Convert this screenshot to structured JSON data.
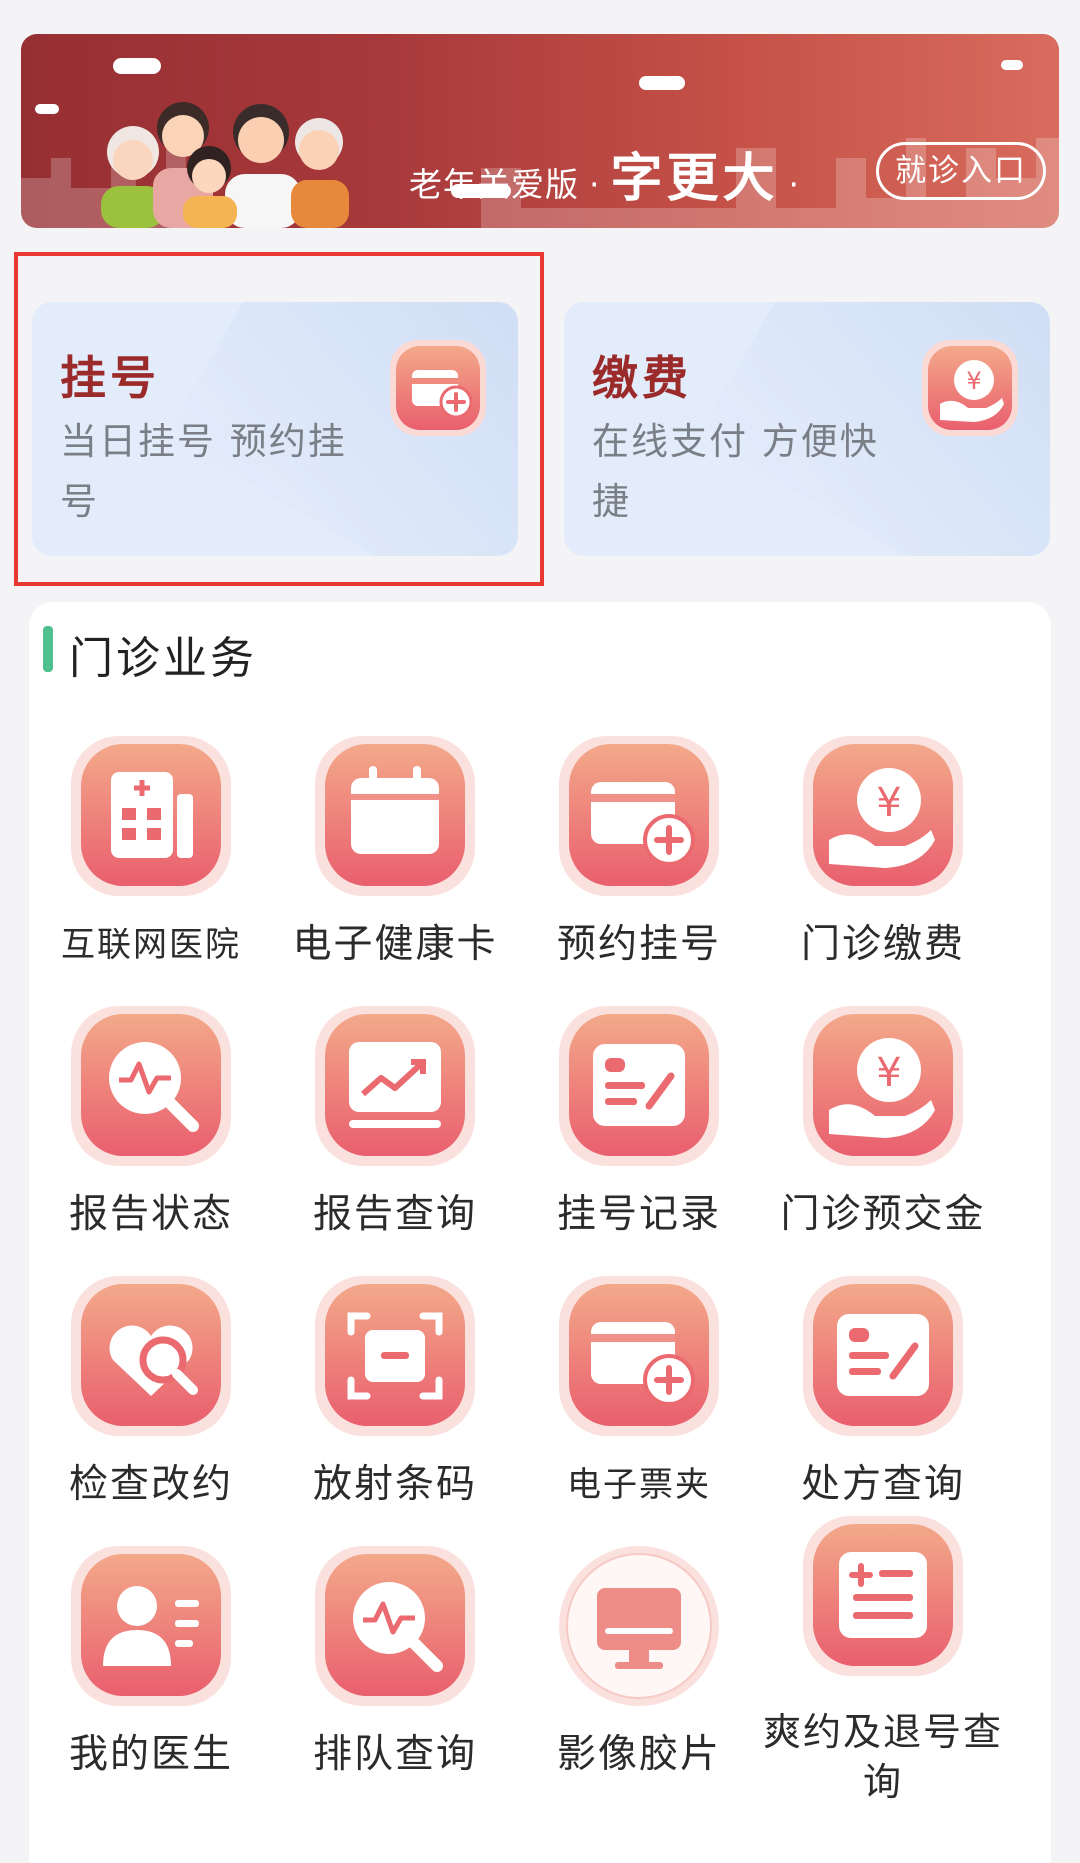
{
  "banner": {
    "version_label": "老年关爱版",
    "big_text": "字更大",
    "entry_label": "就诊入口"
  },
  "quick_cards": [
    {
      "title": "挂号",
      "desc": "当日挂号 预约挂号",
      "icon": "card-plus-icon"
    },
    {
      "title": "缴费",
      "desc": "在线支付 方便快捷",
      "icon": "yuan-hand-icon"
    }
  ],
  "section": {
    "title": "门诊业务",
    "items": [
      {
        "label": "互联网医院",
        "icon": "hospital-icon"
      },
      {
        "label": "电子健康卡",
        "icon": "calendar-icon"
      },
      {
        "label": "预约挂号",
        "icon": "card-plus-icon"
      },
      {
        "label": "门诊缴费",
        "icon": "yuan-hand-icon"
      },
      {
        "label": "报告状态",
        "icon": "pulse-search-icon"
      },
      {
        "label": "报告查询",
        "icon": "trend-chart-icon"
      },
      {
        "label": "挂号记录",
        "icon": "record-pen-icon"
      },
      {
        "label": "门诊预交金",
        "icon": "yuan-hand-icon"
      },
      {
        "label": "检查改约",
        "icon": "heart-search-icon"
      },
      {
        "label": "放射条码",
        "icon": "scan-frame-icon"
      },
      {
        "label": "电子票夹",
        "icon": "card-plus-icon"
      },
      {
        "label": "处方查询",
        "icon": "record-pen-icon"
      },
      {
        "label": "我的医生",
        "icon": "doctor-card-icon"
      },
      {
        "label": "排队查询",
        "icon": "pulse-search-icon"
      },
      {
        "label": "影像胶片",
        "icon": "monitor-icon"
      },
      {
        "label": "爽约及退号查询",
        "icon": "list-plus-icon"
      }
    ]
  },
  "colors": {
    "banner_start": "#962f33",
    "banner_end": "#d86c5e",
    "icon_top": "#f2a487",
    "icon_bottom": "#ea6571",
    "accent_green": "#4fc08d",
    "card_title": "#9b2a2a",
    "highlight_border": "#e8382f"
  }
}
